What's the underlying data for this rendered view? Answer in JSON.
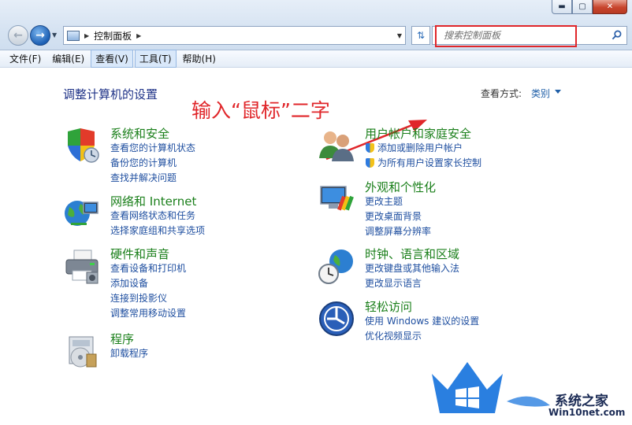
{
  "window": {
    "minimize_label": "▬",
    "maximize_label": "▢",
    "close_label": "✕"
  },
  "nav": {
    "breadcrumb": "控制面板",
    "search_placeholder": "搜索控制面板"
  },
  "menu": [
    "文件(F)",
    "编辑(E)",
    "查看(V)",
    "工具(T)",
    "帮助(H)"
  ],
  "content": {
    "title": "调整计算机的设置",
    "view_by_label": "查看方式:",
    "view_by_value": "类别",
    "annotation": "输入“鼠标”二字"
  },
  "categories": [
    {
      "title": "系统和安全",
      "links": [
        "查看您的计算机状态",
        "备份您的计算机",
        "查找并解决问题"
      ]
    },
    {
      "title": "网络和 Internet",
      "links": [
        "查看网络状态和任务",
        "选择家庭组和共享选项"
      ]
    },
    {
      "title": "硬件和声音",
      "links": [
        "查看设备和打印机",
        "添加设备",
        "连接到投影仪",
        "调整常用移动设置"
      ]
    },
    {
      "title": "程序",
      "links": [
        "卸载程序"
      ]
    },
    {
      "title": "用户帐户和家庭安全",
      "links": [
        "添加或删除用户帐户",
        "为所有用户设置家长控制"
      ]
    },
    {
      "title": "外观和个性化",
      "links": [
        "更改主题",
        "更改桌面背景",
        "调整屏幕分辨率"
      ]
    },
    {
      "title": "时钟、语言和区域",
      "links": [
        "更改键盘或其他输入法",
        "更改显示语言"
      ]
    },
    {
      "title": "轻松访问",
      "links": [
        "使用 Windows 建议的设置",
        "优化视频显示"
      ]
    }
  ],
  "watermark": {
    "name": "系统之家",
    "url": "Win10net.com"
  },
  "colors": {
    "accent_red": "#e0262a",
    "link_blue": "#1f4fa0",
    "category_green": "#1a7f1a",
    "title_blue": "#1e3287"
  }
}
